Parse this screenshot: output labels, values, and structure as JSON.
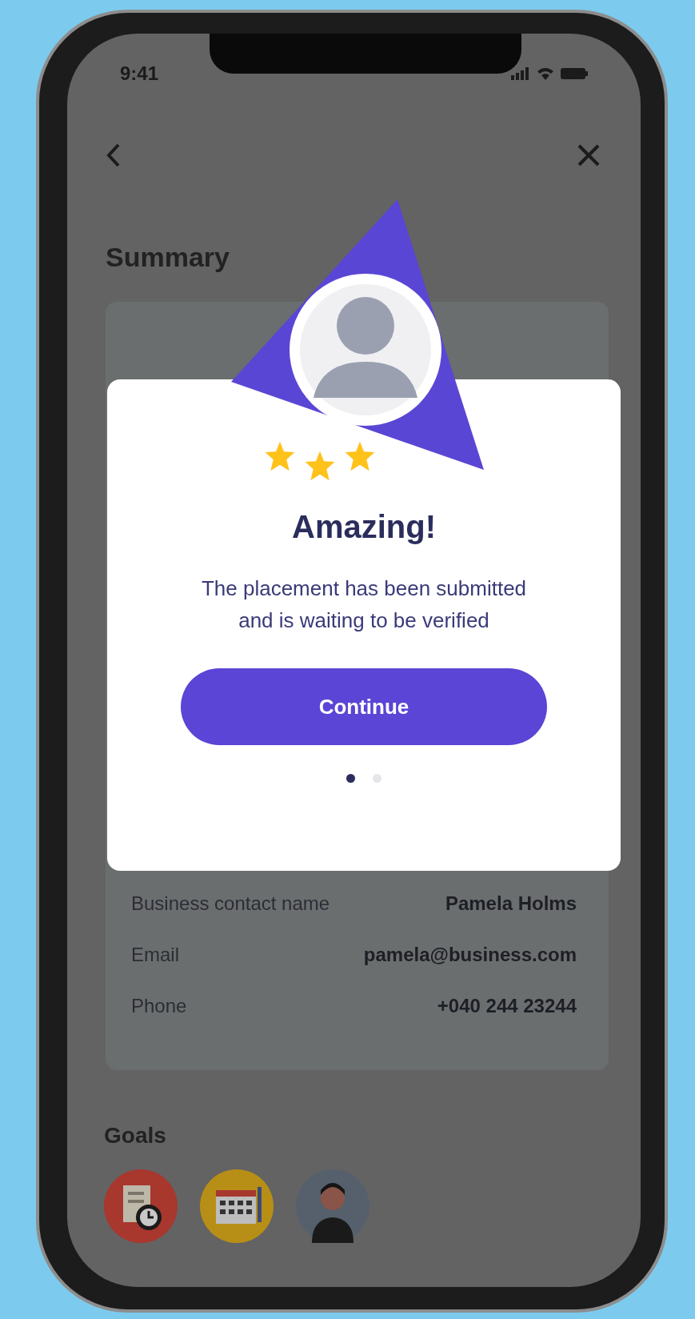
{
  "status_bar": {
    "time": "9:41"
  },
  "header": {
    "title": "Summary"
  },
  "contact": [
    {
      "label": "Business contact name",
      "value": "Pamela Holms"
    },
    {
      "label": "Email",
      "value": "pamela@business.com"
    },
    {
      "label": "Phone",
      "value": "+040 244 23244"
    }
  ],
  "goals": {
    "title": "Goals",
    "items": [
      {
        "kind": "checklist",
        "color": "#a8372e"
      },
      {
        "kind": "calendar",
        "color": "#b88f16"
      },
      {
        "kind": "person",
        "color": "#56606c"
      }
    ]
  },
  "dialog": {
    "stars": 3,
    "title": "Amazing!",
    "message": "The placement has been submitted and is waiting to be verified",
    "button": "Continue",
    "pages": [
      {
        "selected": true
      },
      {
        "selected": false
      }
    ]
  }
}
